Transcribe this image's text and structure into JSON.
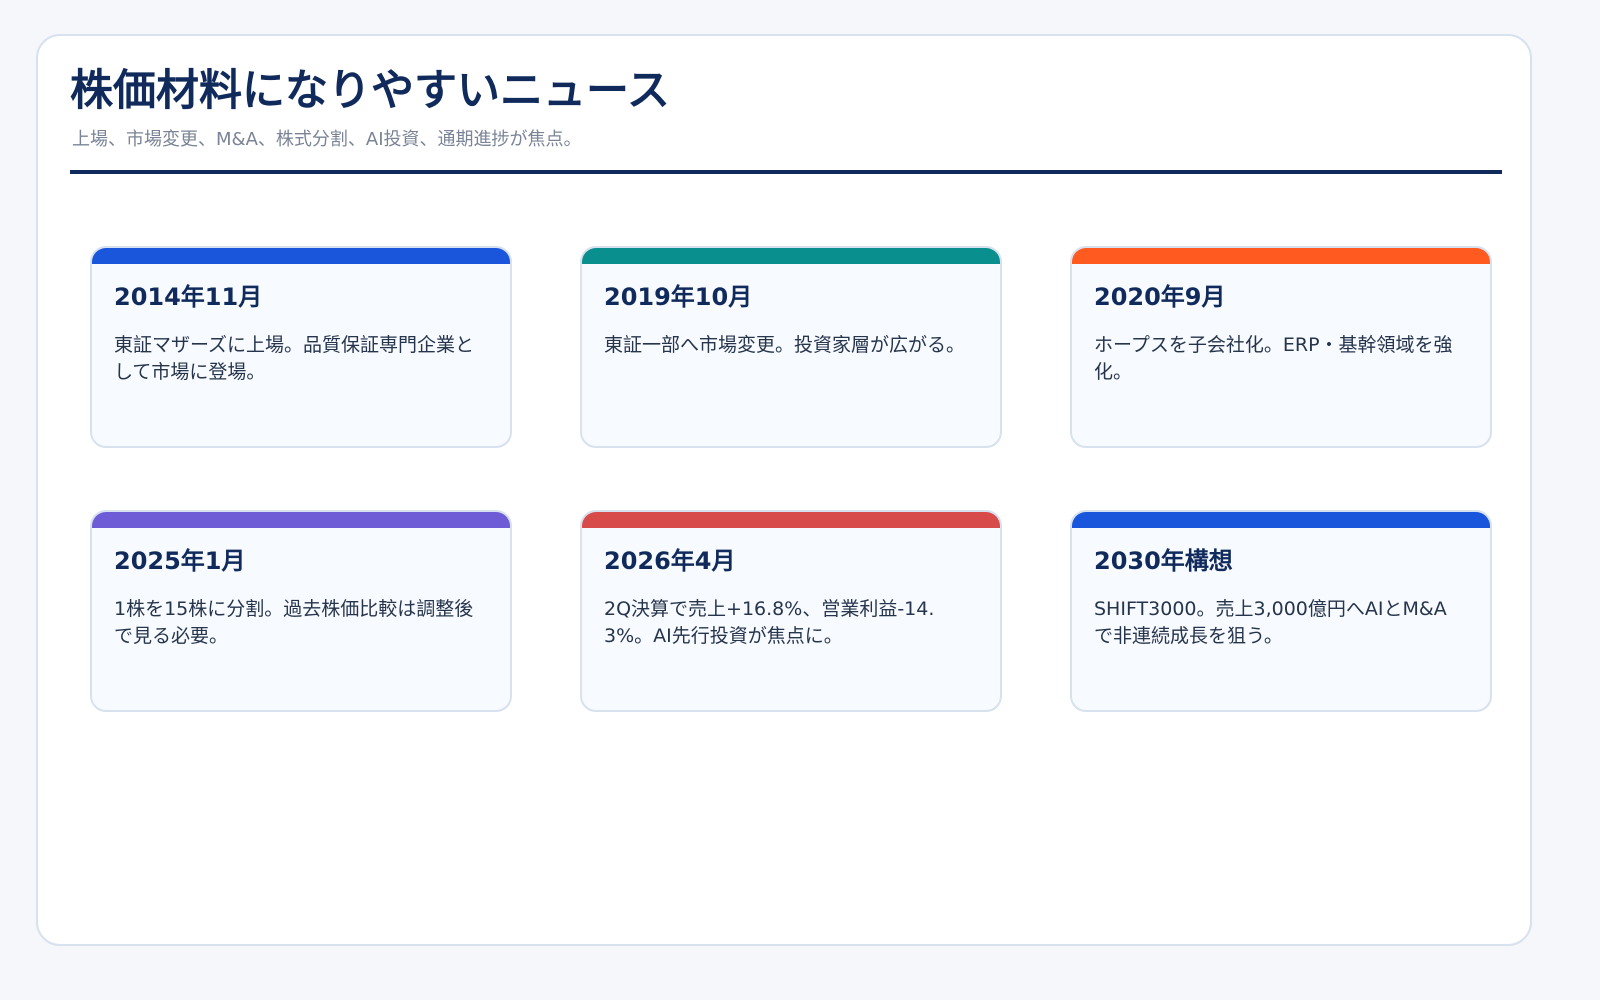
{
  "header": {
    "title": "株価材料になりやすいニュース",
    "subtitle": "上場、市場変更、M&A、株式分割、AI投資、通期進捗が焦点。"
  },
  "cards": [
    {
      "date": "2014年11月",
      "text": "東証マザーズに上場。品質保証専門企業として市場に登場。",
      "accent_color": "#1a56db"
    },
    {
      "date": "2019年10月",
      "text": "東証一部へ市場変更。投資家層が広がる。",
      "accent_color": "#0a8f8f"
    },
    {
      "date": "2020年9月",
      "text": "ホープスを子会社化。ERP・基幹領域を強化。",
      "accent_color": "#ff5a1f"
    },
    {
      "date": "2025年1月",
      "text": "1株を15株に分割。過去株価比較は調整後で見る必要。",
      "accent_color": "#6e5bd6"
    },
    {
      "date": "2026年4月",
      "text": "2Q決算で売上+16.8%、営業利益-14.3%。AI先行投資が焦点に。",
      "accent_color": "#d84b4b"
    },
    {
      "date": "2030年構想",
      "text": "SHIFT3000。売上3,000億円へAIとM&Aで非連続成長を狙う。",
      "accent_color": "#1a56db"
    }
  ]
}
